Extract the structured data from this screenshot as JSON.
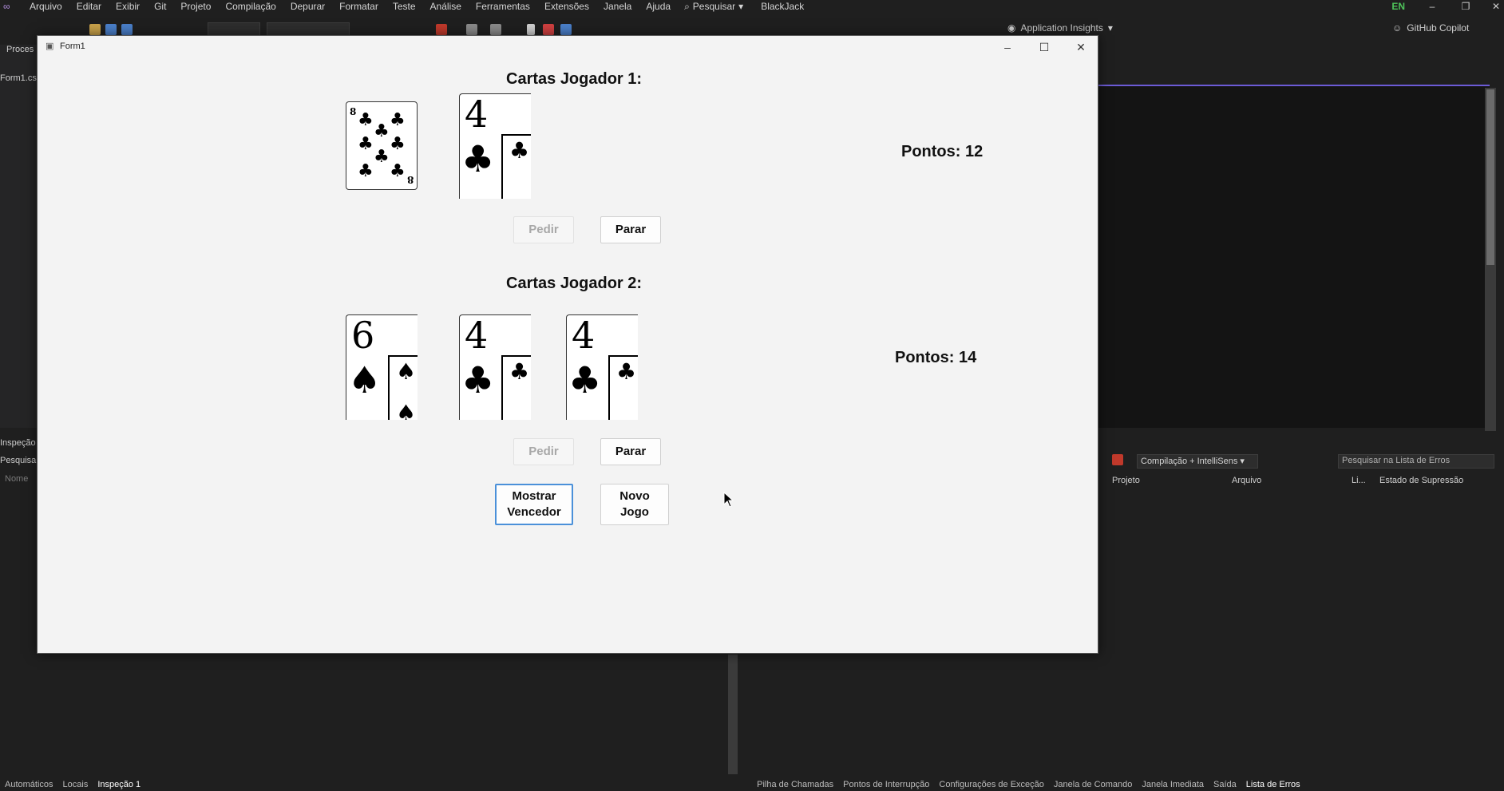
{
  "ide": {
    "menu": [
      "Arquivo",
      "Editar",
      "Exibir",
      "Git",
      "Projeto",
      "Compilação",
      "Depurar",
      "Formatar",
      "Teste",
      "Análise",
      "Ferramentas",
      "Extensões",
      "Janela",
      "Ajuda"
    ],
    "search_label": "Pesquisar",
    "solution_name": "BlackJack",
    "language_badge": "EN",
    "app_insights": "Application Insights",
    "copilot": "GitHub Copilot",
    "left_labels": {
      "process": "Proces",
      "file_tab": "Form1.cs",
      "inspection": "Inspeção",
      "search": "Pesquisa",
      "name": "Nome"
    },
    "error_list": {
      "scope": "Compilação + IntelliSens",
      "search_placeholder": "Pesquisar na Lista de Erros",
      "columns": [
        "Projeto",
        "Arquivo",
        "Li...",
        "Estado de Supressão"
      ]
    },
    "bottom_tabs_left": [
      "Automáticos",
      "Locais",
      "Inspeção 1"
    ],
    "bottom_tabs_right": [
      "Pilha de Chamadas",
      "Pontos de Interrupção",
      "Configurações de Exceção",
      "Janela de Comando",
      "Janela Imediata",
      "Saída",
      "Lista de Erros"
    ]
  },
  "form": {
    "title": "Form1",
    "player1": {
      "title": "Cartas Jogador 1:",
      "points": "Pontos: 12",
      "cards": [
        {
          "rank": "8",
          "suit": "♣",
          "style": "pips"
        },
        {
          "rank": "4",
          "suit": "♣",
          "style": "partial"
        }
      ],
      "hit_label": "Pedir",
      "stand_label": "Parar"
    },
    "player2": {
      "title": "Cartas Jogador 2:",
      "points": "Pontos: 14",
      "cards": [
        {
          "rank": "6",
          "suit": "♠",
          "style": "partial"
        },
        {
          "rank": "4",
          "suit": "♣",
          "style": "partial"
        },
        {
          "rank": "4",
          "suit": "♣",
          "style": "partial"
        }
      ],
      "hit_label": "Pedir",
      "stand_label": "Parar"
    },
    "show_winner_line1": "Mostrar",
    "show_winner_line2": "Vencedor",
    "new_game_line1": "Novo",
    "new_game_line2": "Jogo"
  },
  "icons": {
    "form": "windows-form-icon",
    "minimize": "minimize-icon",
    "maximize": "maximize-icon",
    "close": "close-icon"
  },
  "colors": {
    "accent": "#4a90d9",
    "ide_bg": "#1f1f1f",
    "form_bg": "#f3f3f3"
  }
}
